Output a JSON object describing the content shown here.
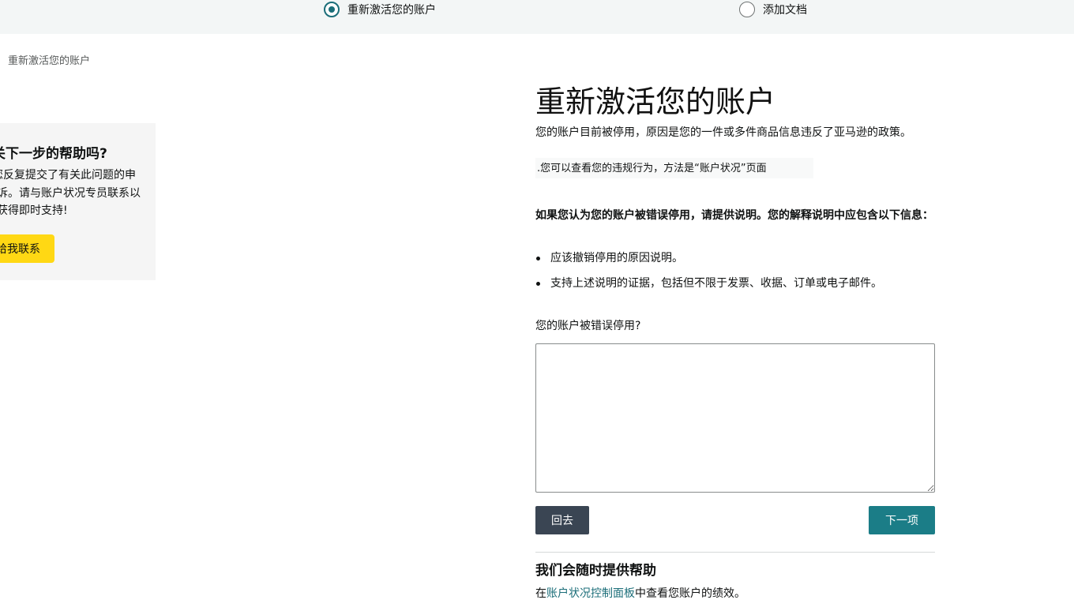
{
  "stepper": {
    "steps": [
      {
        "label": "重新激活您的账户",
        "active": true
      },
      {
        "label": "添加文档",
        "active": false
      }
    ]
  },
  "breadcrumb": "重新激活您的账户",
  "help_card": {
    "title": "关下一步的帮助吗?",
    "text": "注意到您反复提交了有关此问题的申诉。请与账户状况专员联系以获得即时支持!",
    "button": "请给我联系"
  },
  "main": {
    "title": "重新激活您的账户",
    "description": "您的账户目前被停用，原因是您的一件或多件商品信息违反了亚马逊的政策。",
    "violation_link": ".您可以查看您的违规行为，方法是“账户状况”页面",
    "info_title": "如果您认为您的账户被错误停用，请提供说明。您的解释说明中应包含以下信息：",
    "bullets": [
      "应该撤销停用的原因说明。",
      "支持上述说明的证据，包括但不限于发票、收据、订单或电子邮件。"
    ],
    "question_label": "您的账户被错误停用?",
    "answer_value": "",
    "back_button": "回去",
    "next_button": "下一项"
  },
  "footer": {
    "heading": "我们会随时提供帮助",
    "prefix": "在",
    "link": "账户状况控制面板",
    "suffix": "中查看您账户的绩效。"
  },
  "colors": {
    "accent": "#1b6e79",
    "primary_button": "#1b7d87",
    "secondary_button": "#3a4553",
    "contact_button": "#ffd814",
    "stepper_bg": "#f3f6f6"
  }
}
